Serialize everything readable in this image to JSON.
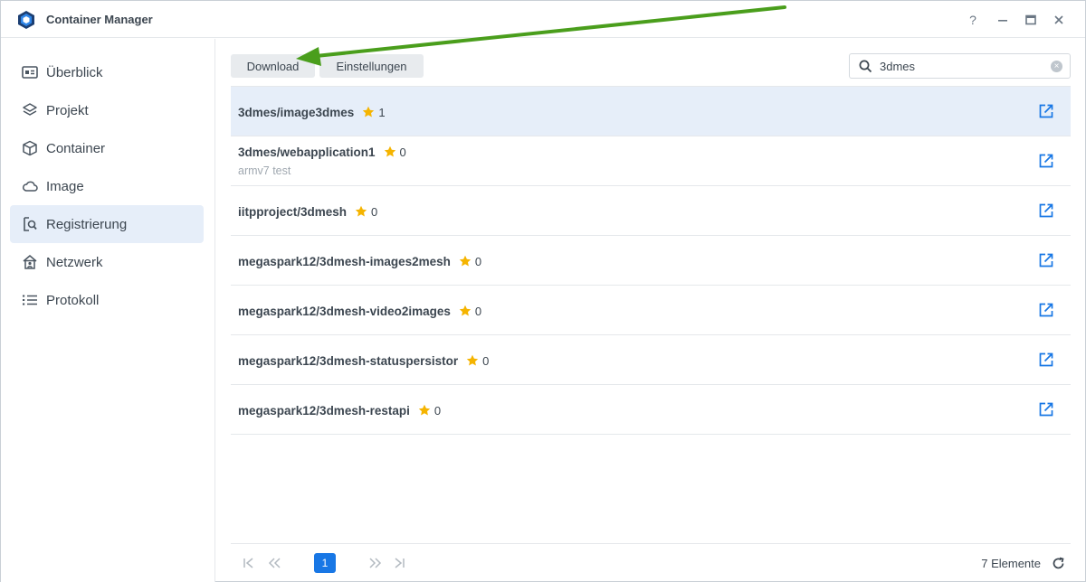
{
  "window": {
    "title": "Container Manager",
    "help_label": "?"
  },
  "sidebar": {
    "items": [
      {
        "label": "Überblick",
        "icon": "overview-icon"
      },
      {
        "label": "Projekt",
        "icon": "layers-icon"
      },
      {
        "label": "Container",
        "icon": "cube-icon"
      },
      {
        "label": "Image",
        "icon": "cloud-icon"
      },
      {
        "label": "Registrierung",
        "icon": "registry-search-icon",
        "active": true
      },
      {
        "label": "Netzwerk",
        "icon": "network-icon"
      },
      {
        "label": "Protokoll",
        "icon": "list-icon"
      }
    ]
  },
  "toolbar": {
    "download_label": "Download",
    "settings_label": "Einstellungen"
  },
  "search": {
    "value": "3dmes",
    "placeholder": ""
  },
  "rows": [
    {
      "name": "3dmes/image3dmes",
      "stars": "1",
      "desc": "",
      "selected": true
    },
    {
      "name": "3dmes/webapplication1",
      "stars": "0",
      "desc": "armv7 test"
    },
    {
      "name": "iitpproject/3dmesh",
      "stars": "0",
      "desc": ""
    },
    {
      "name": "megaspark12/3dmesh-images2mesh",
      "stars": "0",
      "desc": ""
    },
    {
      "name": "megaspark12/3dmesh-video2images",
      "stars": "0",
      "desc": ""
    },
    {
      "name": "megaspark12/3dmesh-statuspersistor",
      "stars": "0",
      "desc": ""
    },
    {
      "name": "megaspark12/3dmesh-restapi",
      "stars": "0",
      "desc": ""
    }
  ],
  "pager": {
    "current_page": "1",
    "total_label": "7 Elemente"
  },
  "colors": {
    "accent": "#1877e5",
    "selected_bg": "#e6eef9",
    "star": "#f5b400",
    "annotation_arrow": "#4a9e1c"
  }
}
